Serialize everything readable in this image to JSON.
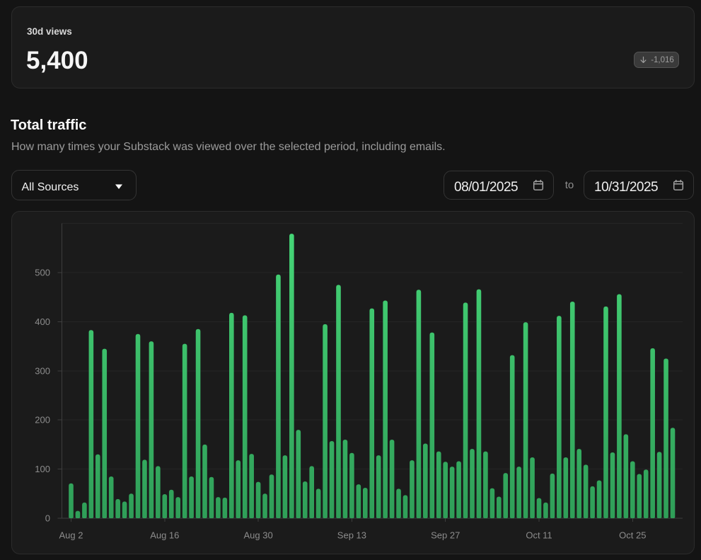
{
  "stat_card": {
    "label": "30d views",
    "value": "5,400",
    "change": "-1,016",
    "change_direction": "down"
  },
  "section": {
    "title": "Total traffic",
    "subtitle": "How many times your Substack was viewed over the selected period, including emails."
  },
  "controls": {
    "source_select": {
      "value": "All Sources"
    },
    "date_range": {
      "start": "08/01/2025",
      "separator": "to",
      "end": "10/31/2025"
    }
  },
  "chart_data": {
    "type": "bar",
    "title": "Total traffic",
    "xlabel": "",
    "ylabel": "",
    "ylim": [
      0,
      600
    ],
    "y_ticks": [
      0,
      100,
      200,
      300,
      400,
      500
    ],
    "grid": true,
    "x_tick_indices": [
      0,
      14,
      28,
      42,
      56,
      70,
      84
    ],
    "x_tick_labels": [
      "Aug 2",
      "Aug 16",
      "Aug 30",
      "Sep 13",
      "Sep 27",
      "Oct 11",
      "Oct 25"
    ],
    "values": [
      71,
      15,
      32,
      383,
      130,
      345,
      85,
      39,
      34,
      50,
      375,
      119,
      360,
      106,
      49,
      58,
      43,
      355,
      85,
      385,
      150,
      84,
      43,
      42,
      418,
      118,
      413,
      131,
      74,
      50,
      89,
      496,
      128,
      579,
      180,
      75,
      106,
      60,
      395,
      157,
      475,
      160,
      133,
      69,
      62,
      427,
      128,
      443,
      160,
      60,
      47,
      118,
      465,
      152,
      378,
      136,
      115,
      105,
      116,
      439,
      141,
      466,
      136,
      61,
      44,
      92,
      332,
      105,
      399,
      124,
      41,
      32,
      91,
      412,
      124,
      441,
      141,
      109,
      65,
      77,
      431,
      134,
      456,
      171,
      116,
      90,
      99,
      346,
      135,
      325,
      184
    ]
  },
  "colors": {
    "page_bg": "#141414",
    "card_bg": "#1b1b1b",
    "card_border": "#2c2c2c",
    "bar_gradient_top": "#46d878",
    "bar_gradient_bottom": "#2f9e58",
    "grid_line": "#252525",
    "axis_line": "#3e3e3e",
    "axis_label": "#8c8c8c"
  }
}
